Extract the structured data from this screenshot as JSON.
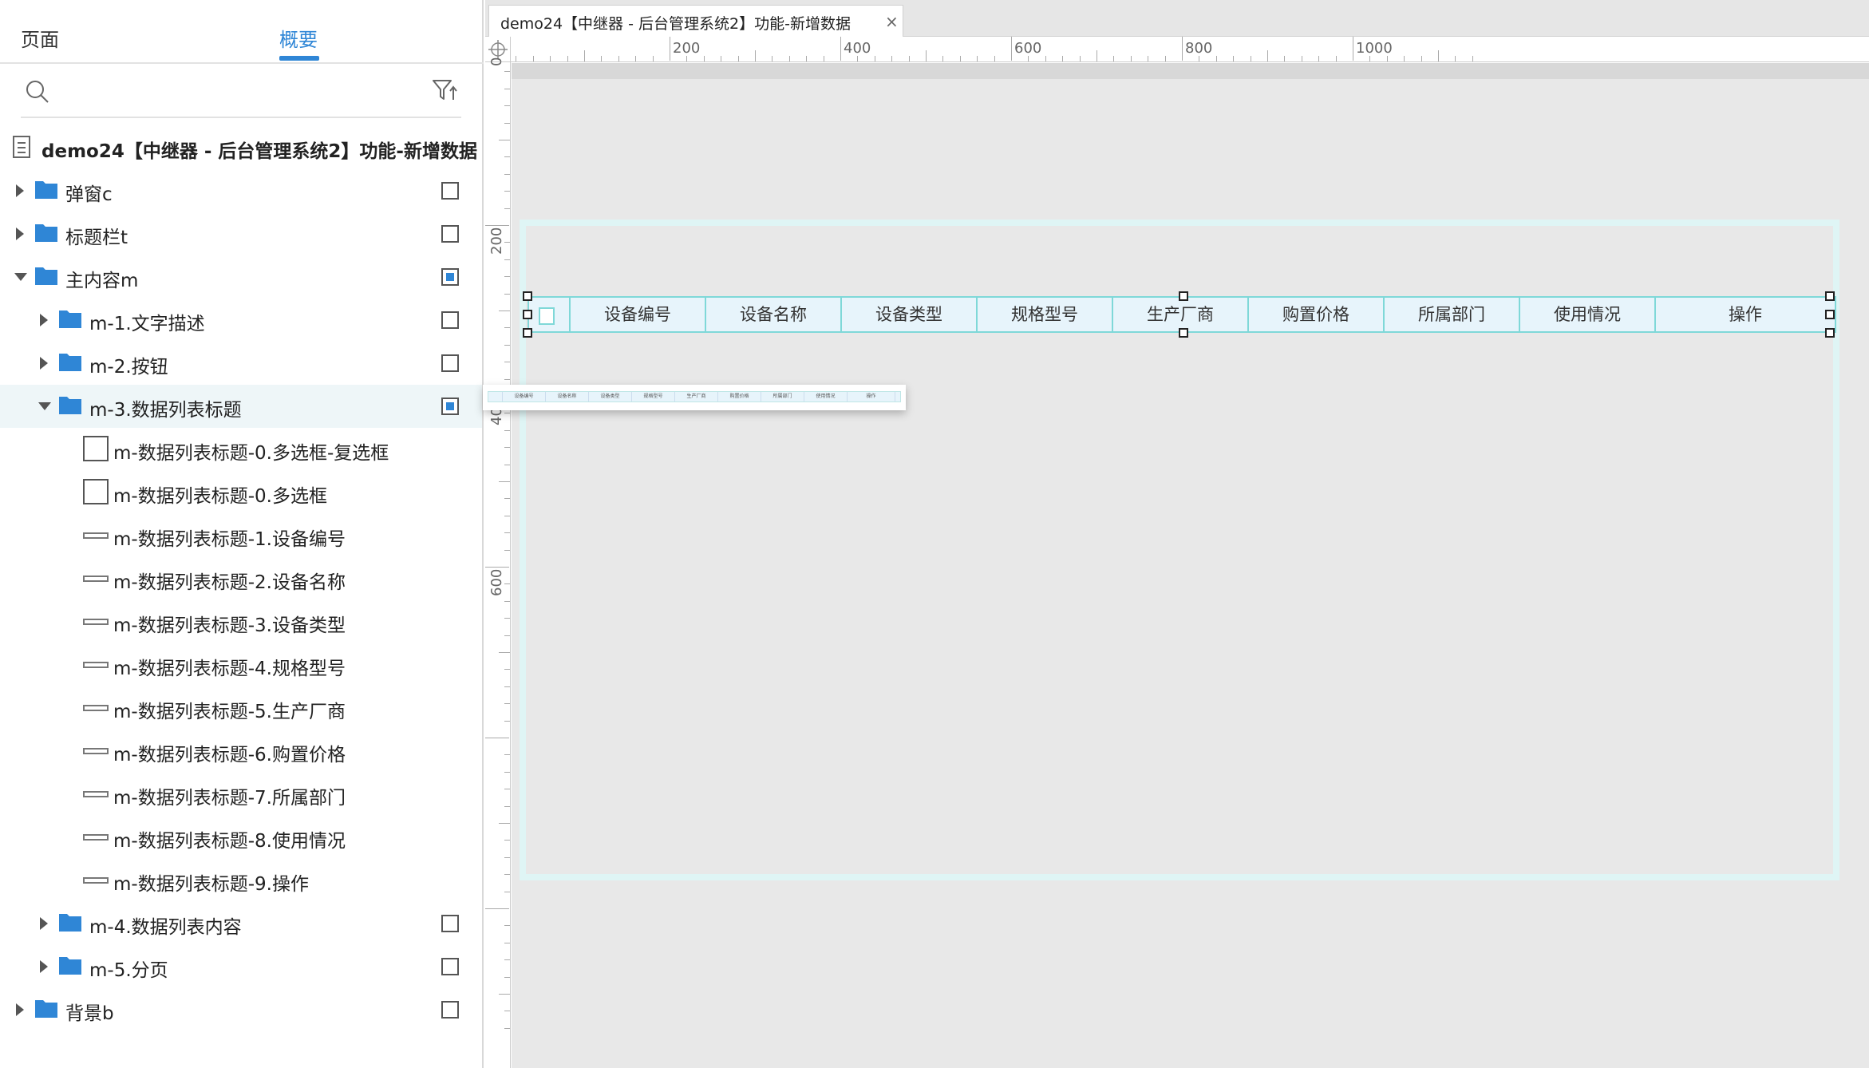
{
  "left_panel": {
    "tabs": {
      "pages": "页面",
      "outline": "概要"
    },
    "search": {
      "placeholder": ""
    },
    "root_title": "demo24【中继器 - 后台管理系统2】功能-新增数据",
    "tree": [
      {
        "label": "弹窗c",
        "kind": "folder",
        "depth": 0,
        "expanded": false,
        "checkbox": "empty"
      },
      {
        "label": "标题栏t",
        "kind": "folder",
        "depth": 0,
        "expanded": false,
        "checkbox": "empty"
      },
      {
        "label": "主内容m",
        "kind": "folder",
        "depth": 0,
        "expanded": true,
        "checkbox": "filled"
      },
      {
        "label": "m-1.文字描述",
        "kind": "folder",
        "depth": 1,
        "expanded": false,
        "checkbox": "empty"
      },
      {
        "label": "m-2.按钮",
        "kind": "folder",
        "depth": 1,
        "expanded": false,
        "checkbox": "empty"
      },
      {
        "label": "m-3.数据列表标题",
        "kind": "folder",
        "depth": 1,
        "expanded": true,
        "checkbox": "filled",
        "selected": true
      },
      {
        "label": "m-数据列表标题-0.多选框-复选框",
        "kind": "box",
        "depth": 2
      },
      {
        "label": "m-数据列表标题-0.多选框",
        "kind": "box",
        "depth": 2
      },
      {
        "label": "m-数据列表标题-1.设备编号",
        "kind": "line",
        "depth": 2
      },
      {
        "label": "m-数据列表标题-2.设备名称",
        "kind": "line",
        "depth": 2
      },
      {
        "label": "m-数据列表标题-3.设备类型",
        "kind": "line",
        "depth": 2
      },
      {
        "label": "m-数据列表标题-4.规格型号",
        "kind": "line",
        "depth": 2
      },
      {
        "label": "m-数据列表标题-5.生产厂商",
        "kind": "line",
        "depth": 2
      },
      {
        "label": "m-数据列表标题-6.购置价格",
        "kind": "line",
        "depth": 2
      },
      {
        "label": "m-数据列表标题-7.所属部门",
        "kind": "line",
        "depth": 2
      },
      {
        "label": "m-数据列表标题-8.使用情况",
        "kind": "line",
        "depth": 2
      },
      {
        "label": "m-数据列表标题-9.操作",
        "kind": "line",
        "depth": 2
      },
      {
        "label": "m-4.数据列表内容",
        "kind": "folder",
        "depth": 1,
        "expanded": false,
        "checkbox": "empty"
      },
      {
        "label": "m-5.分页",
        "kind": "folder",
        "depth": 1,
        "expanded": false,
        "checkbox": "empty"
      },
      {
        "label": "背景b",
        "kind": "folder",
        "depth": 0,
        "expanded": false,
        "checkbox": "empty"
      }
    ]
  },
  "editor": {
    "tab_title": "demo24【中继器 - 后台管理系统2】功能-新增数据",
    "close_glyph": "×",
    "ruler_top_labels": [
      "200",
      "400",
      "600",
      "800",
      "1000"
    ],
    "ruler_left_labels": [
      "0",
      "200",
      "400",
      "600"
    ]
  },
  "table_header": {
    "columns": [
      "设备编号",
      "设备名称",
      "设备类型",
      "规格型号",
      "生产厂商",
      "购置价格",
      "所属部门",
      "使用情况",
      "操作"
    ]
  },
  "colors": {
    "accent": "#2f86d6",
    "header_fill": "#e7f4fb",
    "header_border": "#7fd8d8",
    "frame": "#dff5f5",
    "canvas": "#e8e8e8"
  }
}
